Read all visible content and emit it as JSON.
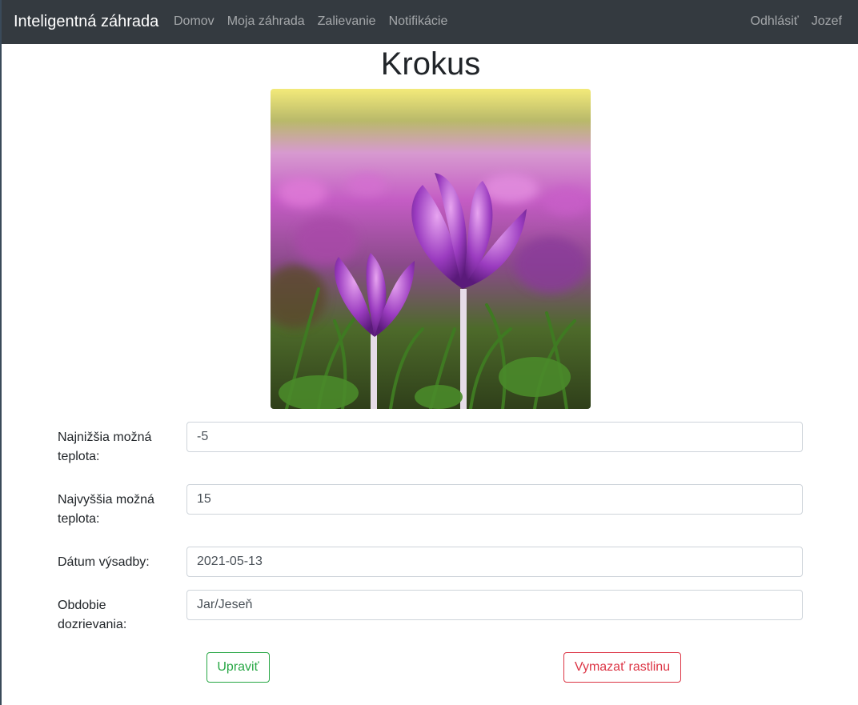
{
  "navbar": {
    "brand": "Inteligentná záhrada",
    "left_links": [
      "Domov",
      "Moja záhrada",
      "Zalievanie",
      "Notifikácie"
    ],
    "right_links": [
      "Odhlásiť",
      "Jozef"
    ]
  },
  "plant": {
    "name": "Krokus",
    "image_alt": "crocus-flower-photo"
  },
  "form": {
    "fields": [
      {
        "label": "Najnižšia možná teplota:",
        "value": "-5"
      },
      {
        "label": "Najvyššia možná teplota:",
        "value": "15"
      },
      {
        "label": "Dátum výsadby:",
        "value": "2021-05-13"
      },
      {
        "label": "Obdobie dozrievania:",
        "value": "Jar/Jeseň"
      }
    ]
  },
  "actions": {
    "edit_label": "Upraviť",
    "delete_label": "Vymazať rastlinu"
  },
  "colors": {
    "navbar_bg": "#343a40",
    "success": "#28a745",
    "danger": "#dc3545"
  }
}
